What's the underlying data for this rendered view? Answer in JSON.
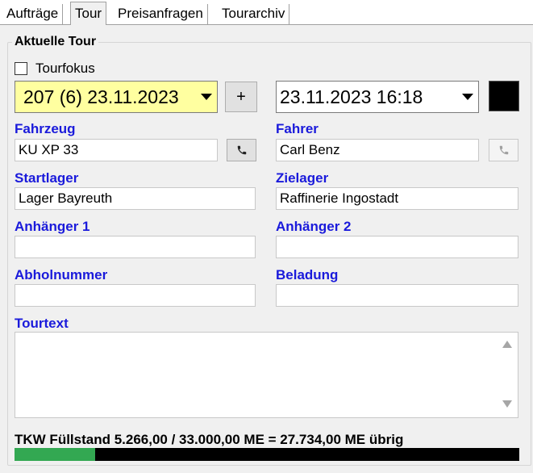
{
  "tabs": [
    {
      "label": "Aufträge"
    },
    {
      "label": "Tour",
      "active": true
    },
    {
      "label": "Preisanfragen"
    },
    {
      "label": "Tourarchiv"
    }
  ],
  "group": {
    "title": "Aktuelle Tour",
    "tourfokus": {
      "label": "Tourfokus",
      "checked": false
    },
    "tour_select": {
      "value": "207 (6) 23.11.2023",
      "bg": "#ffffa0"
    },
    "add_button_label": "+",
    "datetime_select": {
      "value": "23.11.2023 16:18"
    },
    "color_swatch": "#000000",
    "fields": {
      "fahrzeug": {
        "label": "Fahrzeug",
        "value": "KU XP 33"
      },
      "fahrer": {
        "label": "Fahrer",
        "value": "Carl Benz"
      },
      "startlager": {
        "label": "Startlager",
        "value": "Lager Bayreuth"
      },
      "zielager": {
        "label": "Zielager",
        "value": "Raffinerie Ingostadt"
      },
      "anhaenger1": {
        "label": "Anhänger 1",
        "value": ""
      },
      "anhaenger2": {
        "label": "Anhänger 2",
        "value": ""
      },
      "abholnummer": {
        "label": "Abholnummer",
        "value": ""
      },
      "beladung": {
        "label": "Beladung",
        "value": ""
      },
      "tourtext": {
        "label": "Tourtext",
        "value": ""
      }
    },
    "fill_level": {
      "text": "TKW Füllstand 5.266,00 / 33.000,00 ME = 27.734,00 ME übrig",
      "fraction": 0.1596,
      "fill_color": "#33a852"
    }
  },
  "icons": {
    "phone": "phone-icon"
  }
}
